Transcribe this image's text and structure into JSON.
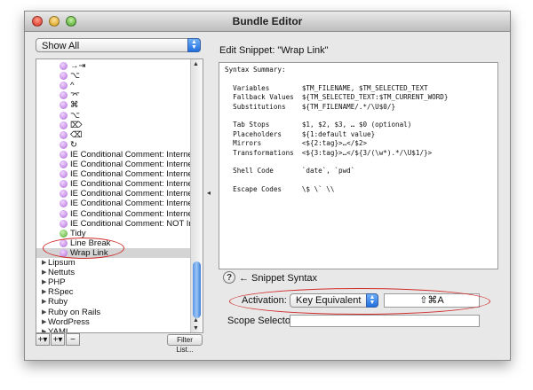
{
  "window": {
    "title": "Bundle Editor"
  },
  "sidebar": {
    "filter_popup": "Show All",
    "items": [
      {
        "label": "→⇥",
        "icon": "snippet-icon"
      },
      {
        "label": "⌥",
        "icon": "snippet-icon"
      },
      {
        "label": "^",
        "icon": "snippet-icon"
      },
      {
        "label": "⌤",
        "icon": "snippet-icon"
      },
      {
        "label": "⌘",
        "icon": "snippet-icon"
      },
      {
        "label": "⌥",
        "icon": "snippet-icon"
      },
      {
        "label": "⌦",
        "icon": "snippet-icon"
      },
      {
        "label": "⌫",
        "icon": "snippet-icon"
      },
      {
        "label": "↻",
        "icon": "snippet-icon"
      },
      {
        "label": "IE Conditional Comment: Internet Expl",
        "icon": "snippet-icon"
      },
      {
        "label": "IE Conditional Comment: Internet Expl",
        "icon": "snippet-icon"
      },
      {
        "label": "IE Conditional Comment: Internet Expl",
        "icon": "snippet-icon"
      },
      {
        "label": "IE Conditional Comment: Internet Expl",
        "icon": "snippet-icon"
      },
      {
        "label": "IE Conditional Comment: Internet Expl",
        "icon": "snippet-icon"
      },
      {
        "label": "IE Conditional Comment: Internet Expl",
        "icon": "snippet-icon"
      },
      {
        "label": "IE Conditional Comment: Internet Expl",
        "icon": "snippet-icon"
      },
      {
        "label": "IE Conditional Comment: NOT Internet",
        "icon": "snippet-icon"
      },
      {
        "label": "Tidy",
        "icon": "command-icon"
      },
      {
        "label": "Line Break",
        "icon": "snippet-icon"
      },
      {
        "label": "Wrap Link",
        "icon": "snippet-icon",
        "selected": true
      }
    ],
    "groups": [
      "Lipsum",
      "Nettuts",
      "PHP",
      "RSpec",
      "Ruby",
      "Ruby on Rails",
      "WordPress",
      "YAML"
    ],
    "add_label": "+",
    "add_group_label": "+",
    "remove_label": "−",
    "filter_list_label": "Filter List..."
  },
  "editor": {
    "title": "Edit Snippet: \"Wrap Link\"",
    "syntax_summary": "Syntax Summary:\n\n  Variables        $TM_FILENAME, $TM_SELECTED_TEXT\n  Fallback Values  ${TM_SELECTED_TEXT:$TM_CURRENT_WORD}\n  Substitutions    ${TM_FILENAME/.*/\\U$0/}\n\n  Tab Stops        $1, $2, $3, … $0 (optional)\n  Placeholders     ${1:default value}\n  Mirrors          <${2:tag}>…</$2>\n  Transformations  <${3:tag}>…</${3/(\\w*).*/\\U$1/}>\n\n  Shell Code       `date`, `pwd`\n\n  Escape Codes     \\$ \\` \\\\",
    "help_label": "?",
    "syntax_link": "← Snippet Syntax"
  },
  "activation": {
    "label": "Activation:",
    "type": "Key Equivalent",
    "key": "⇧⌘A"
  },
  "scope": {
    "label": "Scope Selector:",
    "value": ""
  },
  "colors": {
    "annotation_oval": "#d12c2c",
    "selection_blue": "#3a7bd8"
  }
}
